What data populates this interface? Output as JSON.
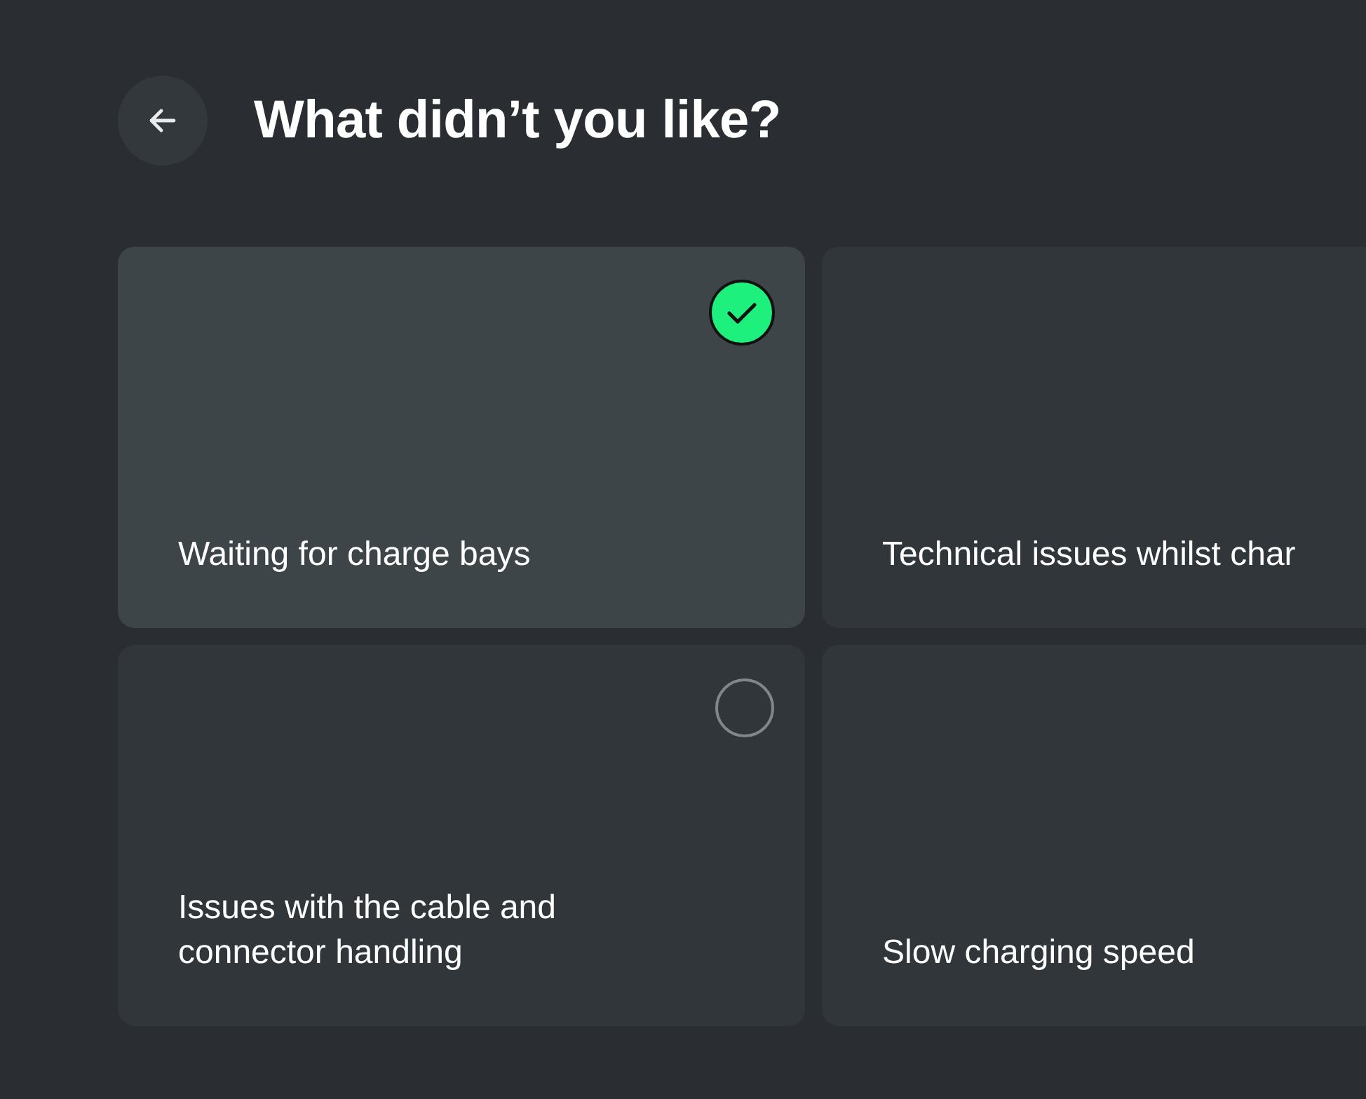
{
  "header": {
    "title": "What didn’t you like?"
  },
  "options": [
    {
      "label": "Waiting for charge bays",
      "selected": true
    },
    {
      "label": "Technical issues whilst char"
    },
    {
      "label": "Issues with the cable and connector handling",
      "selected": false
    },
    {
      "label": "Slow charging speed"
    }
  ]
}
